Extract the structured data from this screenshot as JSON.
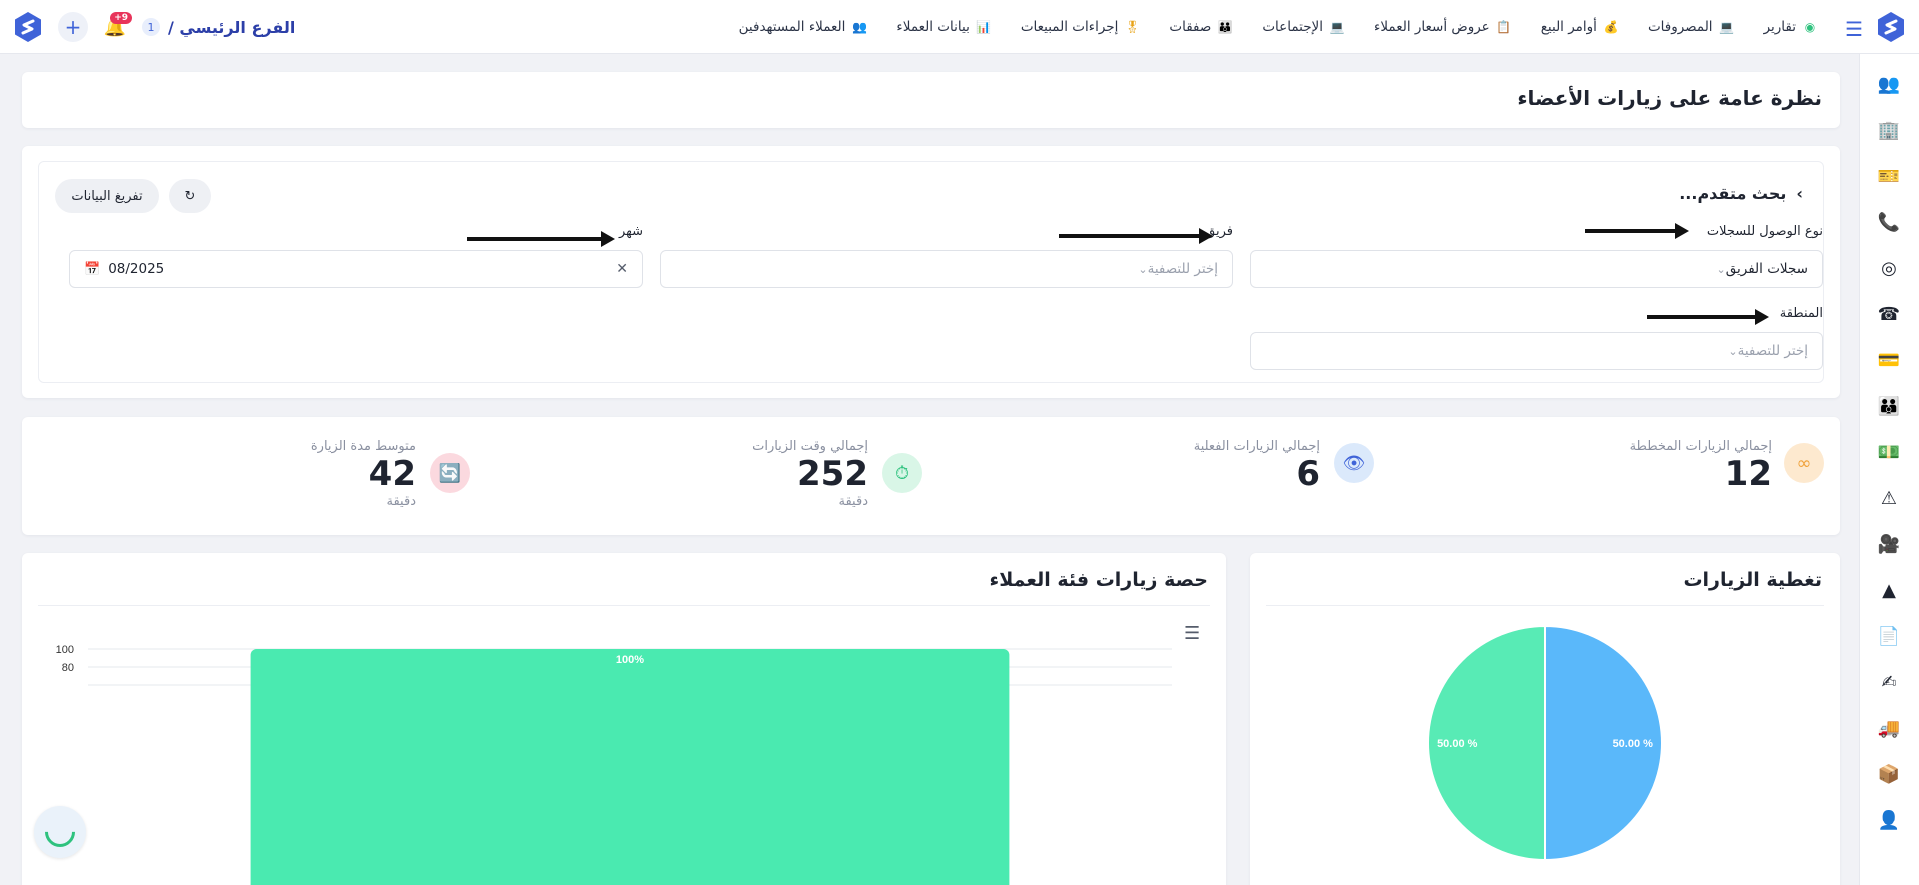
{
  "header": {
    "branch_number": "1",
    "branch_label": "الفرع الرئيسي /",
    "notification_count": "+9",
    "nav": [
      {
        "label": "العملاء المستهدفين",
        "icon": "target-customers-icon",
        "color": "#7b61d6"
      },
      {
        "label": "بيانات العملاء",
        "icon": "customer-data-icon",
        "color": "#3f63d8"
      },
      {
        "label": "إجراءات المبيعات",
        "icon": "sales-medal-icon",
        "color": "#e8a317"
      },
      {
        "label": "صفقات",
        "icon": "deals-team-icon",
        "color": "#3f63d8"
      },
      {
        "label": "الإجتماعات",
        "icon": "meetings-board-icon",
        "color": "#2f7bd8"
      },
      {
        "label": "عروض أسعار العملاء",
        "icon": "quotes-icon",
        "color": "#e8b317"
      },
      {
        "label": "أوامر البيع",
        "icon": "sales-orders-bag-icon",
        "color": "#3f63d8"
      },
      {
        "label": "المصروفات",
        "icon": "expenses-laptop-icon",
        "color": "#2f7bd8"
      },
      {
        "label": "تقارير",
        "icon": "reports-icon",
        "color": "#2ec27e"
      }
    ]
  },
  "page": {
    "title": "نظرة عامة على زيارات الأعضاء"
  },
  "filters": {
    "title": "بحث متقدم...",
    "export_label": "تفريغ البيانات",
    "access_type_label": "نوع الوصول للسجلات",
    "access_type_value": "سجلات الفريق",
    "team_label": "فريق",
    "team_placeholder": "إختر للتصفية",
    "month_label": "شهر",
    "month_value": "08/2025",
    "region_label": "المنطقة",
    "region_placeholder": "إختر للتصفية"
  },
  "kpis": [
    {
      "label": "إجمالي الزيارات المخططة",
      "value": "12",
      "unit": "",
      "icon": "planned-visits-icon",
      "bg": "#fde9cf",
      "fg": "#f0a23b"
    },
    {
      "label": "إجمالي الزيارات الفعلية",
      "value": "6",
      "unit": "",
      "icon": "eye-icon",
      "bg": "#dbe9fb",
      "fg": "#3f63d8"
    },
    {
      "label": "إجمالي وقت الزيارات",
      "value": "252",
      "unit": "دقيقة",
      "icon": "timer-icon",
      "bg": "#d9f6e7",
      "fg": "#2ec27e"
    },
    {
      "label": "متوسط مدة الزيارة",
      "value": "42",
      "unit": "دقيقة",
      "icon": "duration-icon",
      "bg": "#fbd9df",
      "fg": "#e8345a"
    }
  ],
  "charts": {
    "bar_title": "حصة زيارات فئة العملاء",
    "pie_title": "تغطية الزيارات"
  },
  "chart_data": [
    {
      "type": "bar",
      "title": "حصة زيارات فئة العملاء",
      "categories": [
        ""
      ],
      "values": [
        100
      ],
      "data_labels": [
        "100%"
      ],
      "yticks": [
        "100",
        "80"
      ],
      "ylim": [
        0,
        100
      ],
      "color": "#4aeab0",
      "grid": true
    },
    {
      "type": "pie",
      "title": "تغطية الزيارات",
      "values": [
        50,
        50
      ],
      "data_labels": [
        "50.00 %",
        "50.00 %"
      ],
      "colors": [
        "#5ab8fa",
        "#58ebb5"
      ]
    }
  ]
}
